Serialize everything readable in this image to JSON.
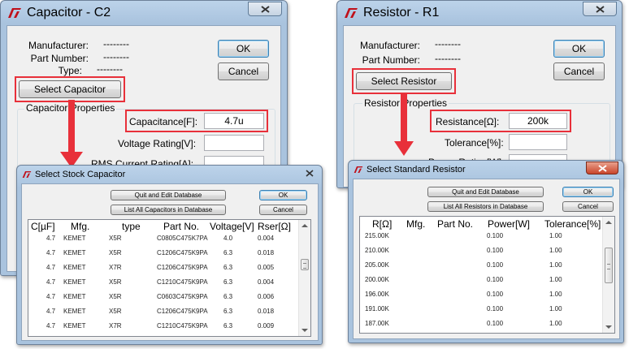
{
  "capacitor_window": {
    "title": "Capacitor - C2",
    "manufacturer_label": "Manufacturer:",
    "manufacturer_value": "--------",
    "part_number_label": "Part Number:",
    "part_number_value": "--------",
    "type_label": "Type:",
    "type_value": "--------",
    "ok_label": "OK",
    "cancel_label": "Cancel",
    "select_button": "Select Capacitor",
    "group_label": "Capacitor Properties",
    "capacitance_label": "Capacitance[F]:",
    "capacitance_value": "4.7u",
    "voltage_label": "Voltage Rating[V]:",
    "rms_label": "RMS Current Rating[A]:"
  },
  "resistor_window": {
    "title": "Resistor - R1",
    "manufacturer_label": "Manufacturer:",
    "manufacturer_value": "--------",
    "part_number_label": "Part Number:",
    "part_number_value": "--------",
    "ok_label": "OK",
    "cancel_label": "Cancel",
    "select_button": "Select Resistor",
    "group_label": "Resistor Properties",
    "resistance_label": "Resistance[Ω]:",
    "resistance_value": "200k",
    "tolerance_label": "Tolerance[%]:",
    "power_label": "Power Rating[W]:"
  },
  "stock_capacitor_dialog": {
    "title": "Select Stock Capacitor",
    "quit_edit_button": "Quit and Edit Database",
    "list_all_button": "List All Capacitors in Database",
    "ok_label": "OK",
    "cancel_label": "Cancel",
    "columns": [
      "C[µF]",
      "Mfg.",
      "type",
      "Part No.",
      "Voltage[V]",
      "Rser[Ω]"
    ],
    "rows": [
      [
        "4.7",
        "KEMET",
        "X5R",
        "C0805C475K7PA",
        "4.0",
        "0.004"
      ],
      [
        "4.7",
        "KEMET",
        "X5R",
        "C1206C475K9PA",
        "6.3",
        "0.018"
      ],
      [
        "4.7",
        "KEMET",
        "X7R",
        "C1206C475K9PA",
        "6.3",
        "0.005"
      ],
      [
        "4.7",
        "KEMET",
        "X5R",
        "C1210C475K9PA",
        "6.3",
        "0.004"
      ],
      [
        "4.7",
        "KEMET",
        "X5R",
        "C0603C475K9PA",
        "6.3",
        "0.006"
      ],
      [
        "4.7",
        "KEMET",
        "X5R",
        "C1206C475K9PA",
        "6.3",
        "0.018"
      ],
      [
        "4.7",
        "KEMET",
        "X7R",
        "C1210C475K9PA",
        "6.3",
        "0.009"
      ]
    ]
  },
  "standard_resistor_dialog": {
    "title": "Select Standard Resistor",
    "quit_edit_button": "Quit and Edit Database",
    "list_all_button": "List All Resistors in Database",
    "ok_label": "OK",
    "cancel_label": "Cancel",
    "columns": [
      "R[Ω]",
      "Mfg.",
      "Part No.",
      "Power[W]",
      "Tolerance[%]"
    ],
    "rows": [
      [
        "215.00K",
        "",
        "",
        "0.100",
        "1.00"
      ],
      [
        "210.00K",
        "",
        "",
        "0.100",
        "1.00"
      ],
      [
        "205.00K",
        "",
        "",
        "0.100",
        "1.00"
      ],
      [
        "200.00K",
        "",
        "",
        "0.100",
        "1.00"
      ],
      [
        "196.00K",
        "",
        "",
        "0.100",
        "1.00"
      ],
      [
        "191.00K",
        "",
        "",
        "0.100",
        "1.00"
      ],
      [
        "187.00K",
        "",
        "",
        "0.100",
        "1.00"
      ]
    ]
  },
  "colors": {
    "highlight": "#e8303a",
    "title_bar": "#a9c3de",
    "client": "#f0f0f0"
  },
  "icons": {
    "logo": "ltspice-logo-icon",
    "close": "close-icon",
    "arrow": "arrow-down-icon"
  }
}
